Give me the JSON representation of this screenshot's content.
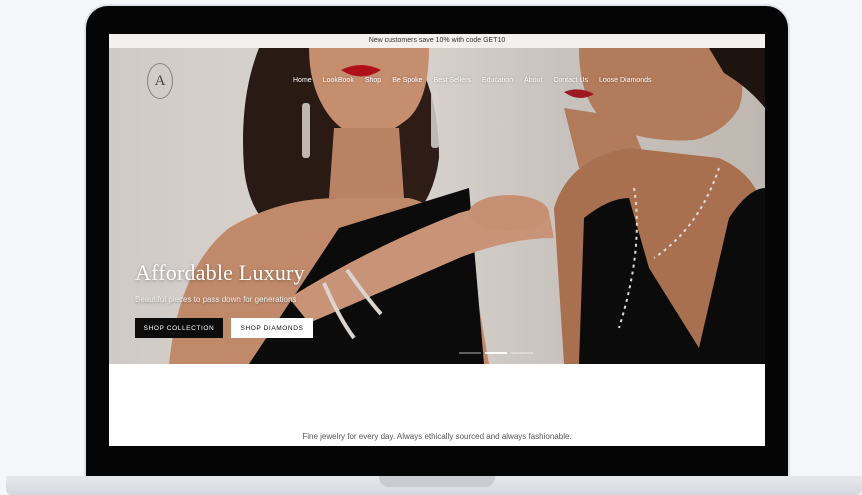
{
  "announcement": "New customers save 10% with code GET10",
  "logo": {
    "letter": "A"
  },
  "nav": {
    "items": [
      "Home",
      "LookBook",
      "Shop",
      "Be Spoke",
      "Best Sellers",
      "Education",
      "About",
      "Contact Us",
      "Loose Diamonds"
    ]
  },
  "hero": {
    "title": "Affordable Luxury",
    "subtitle": "Beautiful pieces to pass down for generations",
    "primary_button": "SHOP COLLECTION",
    "secondary_button": "SHOP DIAMONDS",
    "carousel": {
      "slides": 3,
      "active_index": 1
    }
  },
  "tagline": "Fine jewelry for every day. Always ethically sourced and always fashionable.",
  "colors": {
    "button_dark": "#0c0c0c",
    "button_light": "#ffffff",
    "lips": "#b0101a",
    "dress": "#0b0b0b"
  }
}
